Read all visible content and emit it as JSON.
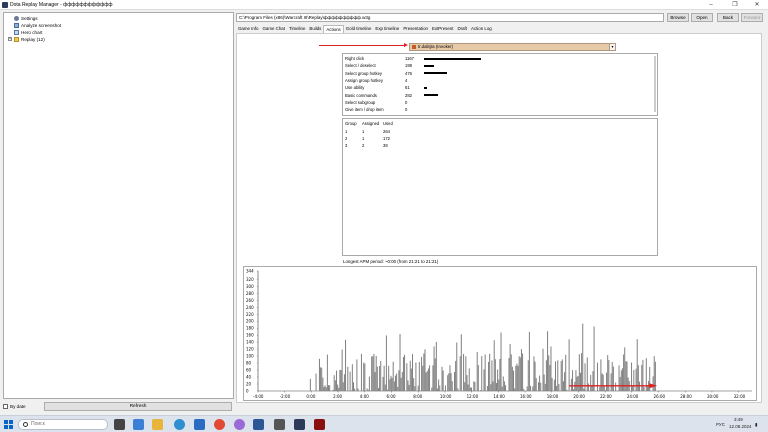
{
  "window": {
    "title": "Dota Replay Manager - фффффффффффф",
    "minimize": "–",
    "maximize": "❐",
    "close": "✕"
  },
  "tree": {
    "items": [
      {
        "label": "Settings",
        "icon": "gear-icon"
      },
      {
        "label": "Analyze screenshot",
        "icon": "image-icon"
      },
      {
        "label": "Hero chart",
        "icon": "chart-icon"
      },
      {
        "label": "Replay (12)",
        "icon": "folder-icon",
        "expander": "+"
      }
    ]
  },
  "bottom_left": {
    "bydate_label": "By date",
    "refresh_label": "Refresh"
  },
  "toolbar": {
    "path": "C:\\Program Files (x86)\\Warcraft III\\Replay\\фффффффффф.w3g",
    "browse": "Browse",
    "open": "Open",
    "back": "Back",
    "forward": "Forward"
  },
  "tabs": [
    "Game Info",
    "Game Chat",
    "Timeline",
    "Builds",
    "Actions",
    "Gold timeline",
    "Exp timeline",
    "Presentation",
    "ExtPresent",
    "Draft",
    "Action Log"
  ],
  "active_tab": "Actions",
  "player_select": {
    "value": "tr.dalitjra (Invoker)",
    "race_color": "#c85a2a",
    "dropdown_icon": "chevron-down-icon"
  },
  "actions_stats": [
    {
      "label": "Right click",
      "value": "1167",
      "fraction": 1.0
    },
    {
      "label": "Select / deselect",
      "value": "199",
      "fraction": 0.17
    },
    {
      "label": "Select group hotkey",
      "value": "476",
      "fraction": 0.41
    },
    {
      "label": "Assign group hotkey",
      "value": "4",
      "fraction": 0.0
    },
    {
      "label": "Use ability",
      "value": "61",
      "fraction": 0.05
    },
    {
      "label": "Basic commands",
      "value": "282",
      "fraction": 0.24
    },
    {
      "label": "Select subgroup",
      "value": "0",
      "fraction": 0
    },
    {
      "label": "Give item / drop item",
      "value": "0",
      "fraction": 0
    }
  ],
  "groups": {
    "headers": [
      "Group",
      "Assigned",
      "Used"
    ],
    "rows": [
      [
        "1",
        "1",
        "264"
      ],
      [
        "2",
        "1",
        "172"
      ],
      [
        "3",
        "2",
        "39"
      ]
    ]
  },
  "apm_label": "Longest APM period: ~0:00 (from 21:21 to 21:21)",
  "chart_data": {
    "type": "bar",
    "ylim": [
      0,
      344
    ],
    "y_ticks": [
      "0",
      "20",
      "40",
      "60",
      "80",
      "100",
      "120",
      "140",
      "160",
      "180",
      "200",
      "220",
      "240",
      "260",
      "280",
      "300",
      "320",
      "344"
    ],
    "x_ticks": [
      "-4:00",
      "-2:00",
      "0:00",
      "2:00",
      "4:00",
      "6:00",
      "8:00",
      "10:00",
      "12:00",
      "14:00",
      "16:00",
      "18:00",
      "20:00",
      "22:00",
      "24:00",
      "26:00",
      "28:00",
      "30:00",
      "32:00"
    ],
    "x_range_minutes": [
      -4,
      33
    ],
    "bar_color": "#808080",
    "annotation_color": "#dd2222"
  },
  "taskbar": {
    "search_placeholder": "Поиск",
    "lang": "РУС",
    "time": "3:49",
    "date": "12.08.2024"
  }
}
